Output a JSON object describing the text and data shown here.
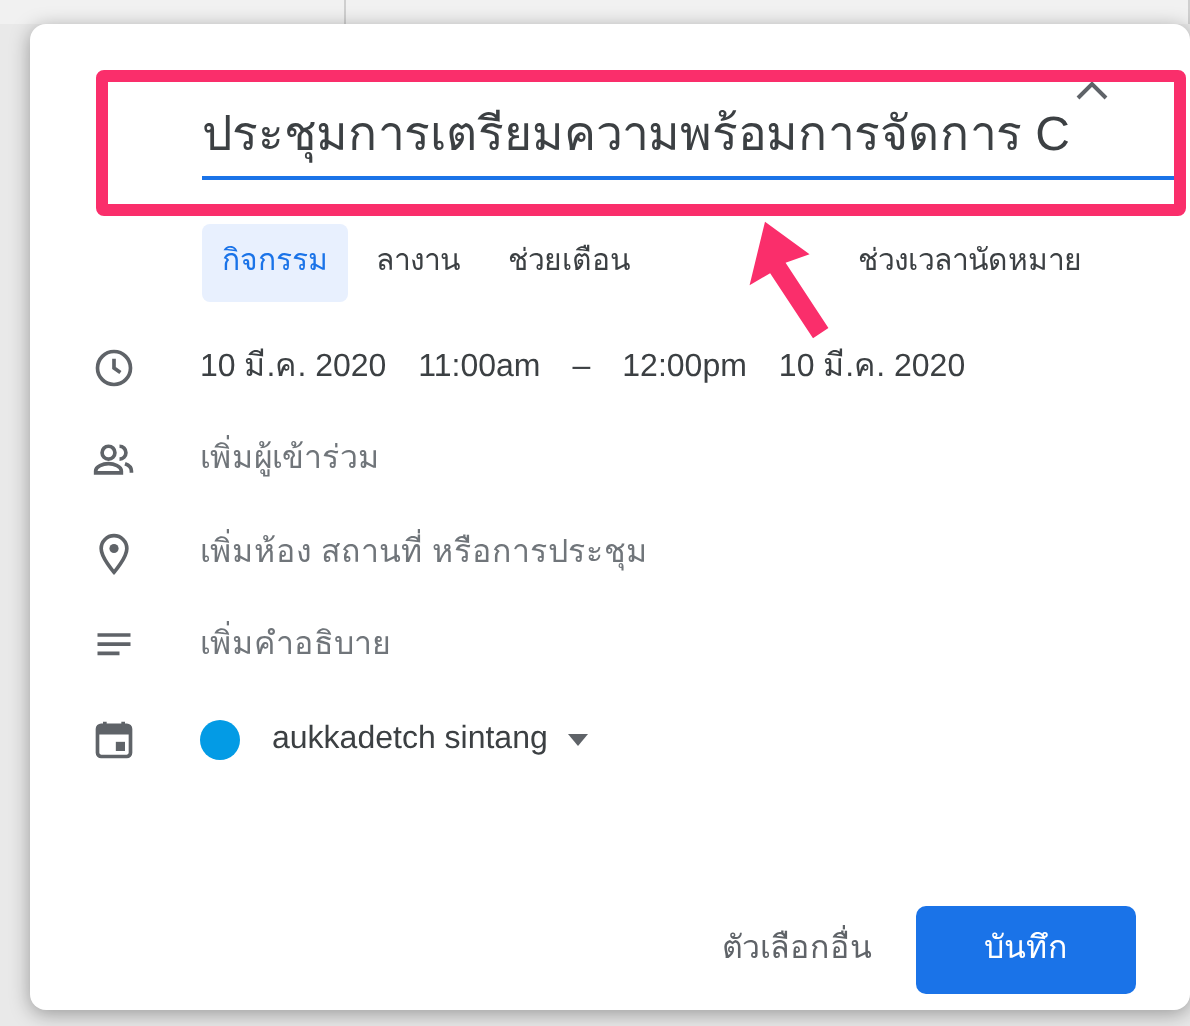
{
  "title_field": {
    "value": "ประชุมการเตรียมความพร้อมการจัดการ C"
  },
  "tabs": [
    {
      "label": "กิจกรรม",
      "selected": true
    },
    {
      "label": "ลางาน",
      "selected": false
    },
    {
      "label": "ช่วยเตือน",
      "selected": false
    },
    {
      "label": "ช่วงเวลานัดหมาย",
      "selected": false
    }
  ],
  "rows": [
    {
      "kind": "datetime",
      "start_date": "10 มี.ค. 2020",
      "start_time": "11:00am",
      "separator": "–",
      "end_time": "12:00pm",
      "end_date": "10 มี.ค. 2020"
    },
    {
      "kind": "guests",
      "placeholder": "เพิ่มผู้เข้าร่วม"
    },
    {
      "kind": "location",
      "placeholder": "เพิ่มห้อง สถานที่ หรือการประชุม"
    },
    {
      "kind": "description",
      "placeholder": "เพิ่มคำอธิบาย"
    },
    {
      "kind": "calendar",
      "name": "aukkadetch sintang",
      "color": "#039be5"
    }
  ],
  "buttons": [
    {
      "kind": "text",
      "label": "ตัวเลือกอื่น"
    },
    {
      "kind": "primary",
      "label": "บันทึก"
    }
  ]
}
